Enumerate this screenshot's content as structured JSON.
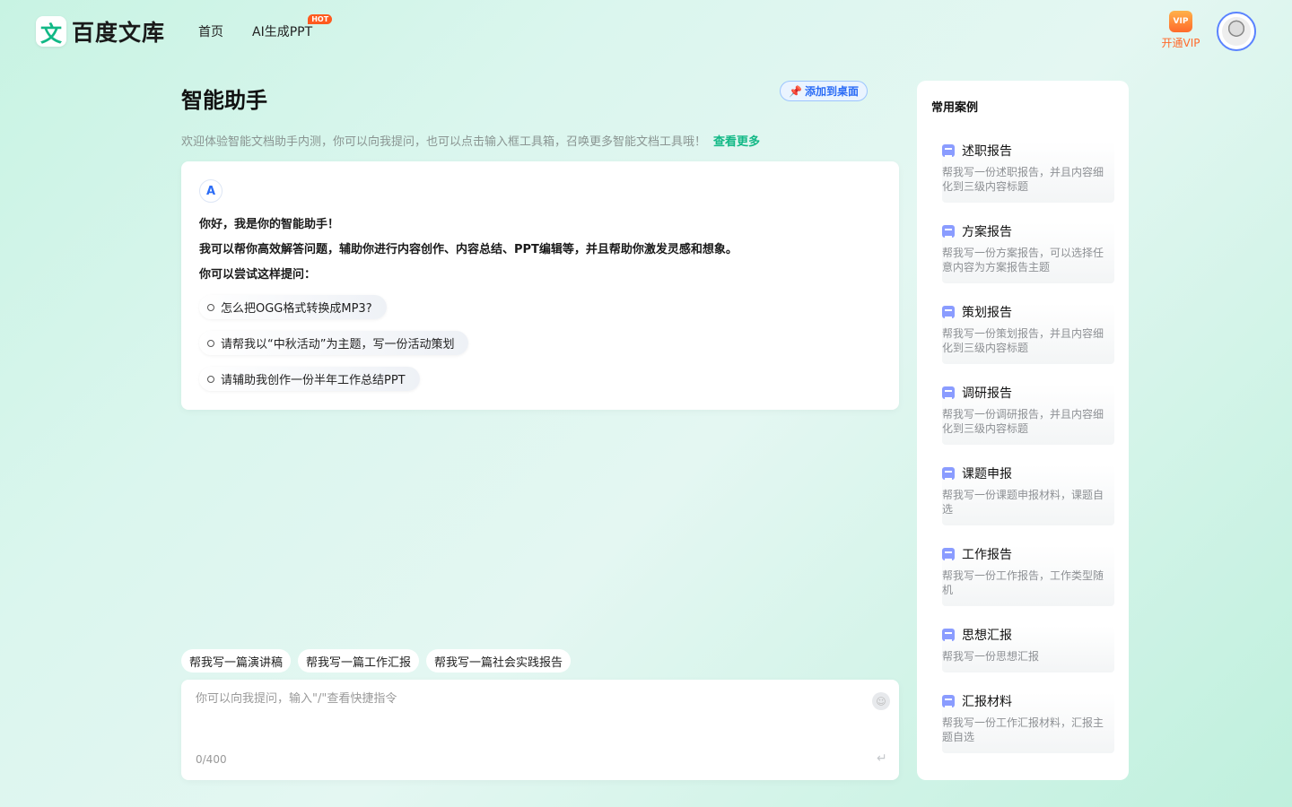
{
  "header": {
    "logo_mark": "文",
    "logo_text": "百度文库",
    "nav": [
      {
        "label": "首页"
      },
      {
        "label": "AI生成PPT",
        "badge": "HOT"
      }
    ],
    "vip_icon_text": "VIP",
    "vip_label": "开通VIP"
  },
  "main": {
    "title": "智能助手",
    "pin_label": "添加到桌面",
    "intro": "欢迎体验智能文档助手内测，你可以向我提问，也可以点击输入框工具箱，召唤更多智能文档工具哦！",
    "intro_link": "查看更多",
    "bot_avatar": "A",
    "greeting": "你好，我是你的智能助手！",
    "capability": "我可以帮你高效解答问题，辅助你进行内容创作、内容总结、PPT编辑等，并且帮助你激发灵感和想象。",
    "try_prompt": "你可以尝试这样提问：",
    "suggestions": [
      "怎么把OGG格式转换成MP3?",
      "请帮我以“中秋活动”为主题，写一份活动策划",
      "请辅助我创作一份半年工作总结PPT"
    ],
    "quick_prompts": [
      "帮我写一篇演讲稿",
      "帮我写一篇工作汇报",
      "帮我写一篇社会实践报告"
    ],
    "input": {
      "placeholder": "你可以向我提问，输入\"/\"查看快捷指令",
      "value": "",
      "counter": "0/400"
    }
  },
  "side": {
    "title": "常用案例",
    "cases": [
      {
        "title": "述职报告",
        "desc": "帮我写一份述职报告，并且内容细化到三级内容标题"
      },
      {
        "title": "方案报告",
        "desc": "帮我写一份方案报告，可以选择任意内容为方案报告主题"
      },
      {
        "title": "策划报告",
        "desc": "帮我写一份策划报告，并且内容细化到三级内容标题"
      },
      {
        "title": "调研报告",
        "desc": "帮我写一份调研报告，并且内容细化到三级内容标题"
      },
      {
        "title": "课题申报",
        "desc": "帮我写一份课题申报材料，课题自选"
      },
      {
        "title": "工作报告",
        "desc": "帮我写一份工作报告，工作类型随机"
      },
      {
        "title": "思想汇报",
        "desc": "帮我写一份思想汇报"
      },
      {
        "title": "汇报材料",
        "desc": "帮我写一份工作汇报材料，汇报主题自选"
      }
    ]
  }
}
